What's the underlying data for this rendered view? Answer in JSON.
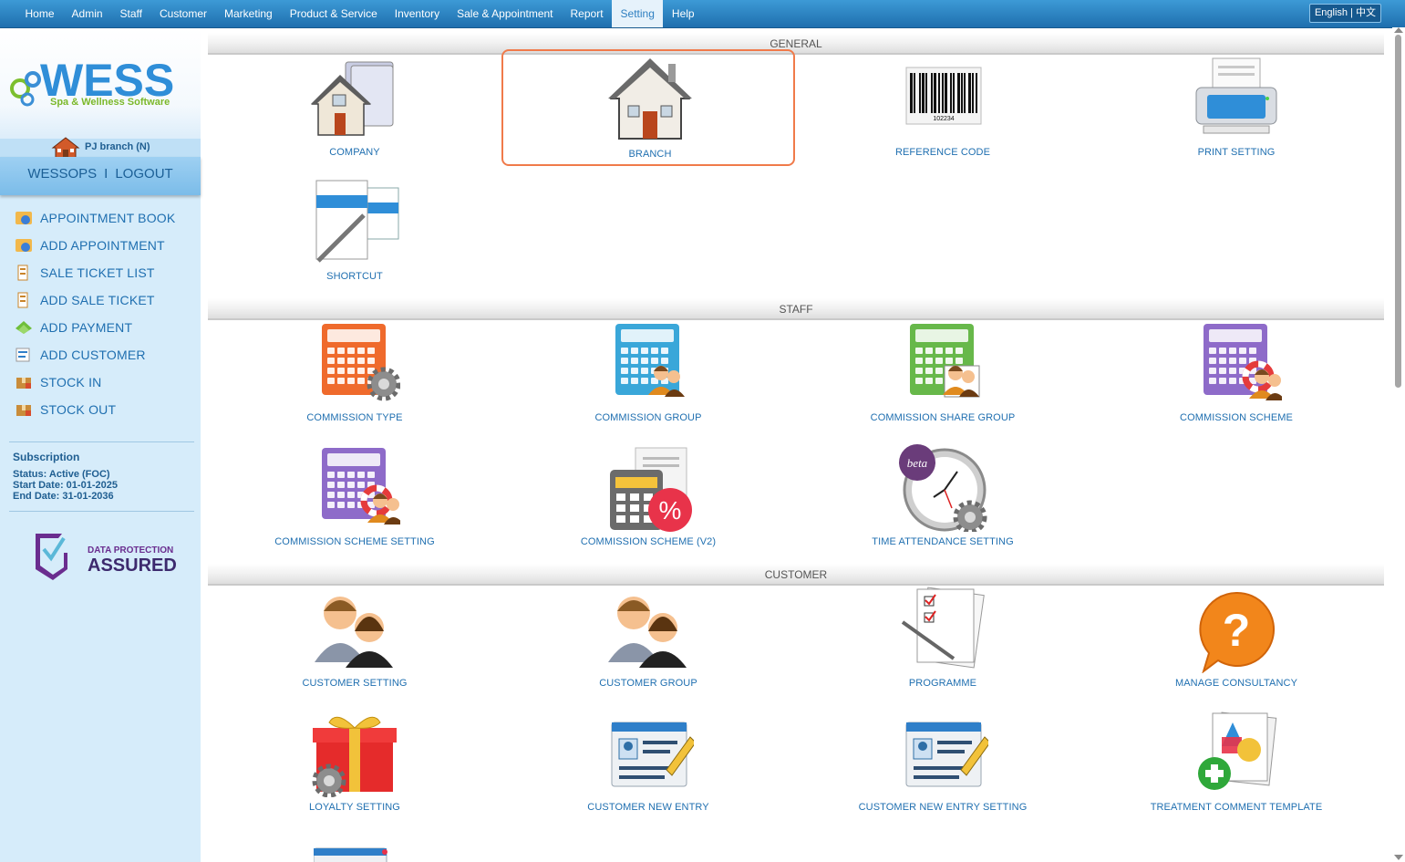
{
  "topnav": {
    "items": [
      "Home",
      "Admin",
      "Staff",
      "Customer",
      "Marketing",
      "Product & Service",
      "Inventory",
      "Sale & Appointment",
      "Report",
      "Setting",
      "Help"
    ],
    "active": "Setting",
    "language": "English | 中文"
  },
  "sidebar": {
    "logo": {
      "text": "WESS",
      "tagline": "Spa & Wellness Software"
    },
    "branch_name": "PJ branch (N)",
    "account": {
      "username": "WESSOPS",
      "separator": "I",
      "logout": "LOGOUT"
    },
    "menu": [
      {
        "label": "APPOINTMENT BOOK",
        "icon": "appointment-book-icon"
      },
      {
        "label": "ADD APPOINTMENT",
        "icon": "add-appointment-icon"
      },
      {
        "label": "SALE TICKET LIST",
        "icon": "sale-ticket-list-icon"
      },
      {
        "label": "ADD SALE TICKET",
        "icon": "add-sale-ticket-icon"
      },
      {
        "label": "ADD PAYMENT",
        "icon": "add-payment-icon"
      },
      {
        "label": "ADD CUSTOMER",
        "icon": "add-customer-icon"
      },
      {
        "label": "STOCK IN",
        "icon": "stock-in-icon"
      },
      {
        "label": "STOCK OUT",
        "icon": "stock-out-icon"
      }
    ],
    "subscription": {
      "title": "Subscription",
      "status": "Status: Active (FOC)",
      "start": "Start Date: 01-01-2025",
      "end": "End Date: 31-01-2036"
    },
    "badge": {
      "line1": "DATA PROTECTION",
      "line2": "ASSURED"
    }
  },
  "sections": [
    {
      "title": "GENERAL",
      "tiles": [
        {
          "label": "COMPANY",
          "icon": "company-icon"
        },
        {
          "label": "BRANCH",
          "icon": "branch-icon",
          "selected": true
        },
        {
          "label": "REFERENCE CODE",
          "icon": "barcode-icon",
          "barcode_number": "102234"
        },
        {
          "label": "PRINT SETTING",
          "icon": "printer-icon"
        },
        {
          "label": "SHORTCUT",
          "icon": "shortcut-icon"
        }
      ]
    },
    {
      "title": "STAFF",
      "tiles": [
        {
          "label": "COMMISSION TYPE",
          "icon": "commission-type-icon"
        },
        {
          "label": "COMMISSION GROUP",
          "icon": "commission-group-icon"
        },
        {
          "label": "COMMISSION SHARE GROUP",
          "icon": "commission-share-group-icon"
        },
        {
          "label": "COMMISSION SCHEME",
          "icon": "commission-scheme-icon"
        },
        {
          "label": "COMMISSION SCHEME SETTING",
          "icon": "commission-scheme-setting-icon"
        },
        {
          "label": "COMMISSION SCHEME (V2)",
          "icon": "commission-scheme-v2-icon"
        },
        {
          "label": "TIME ATTENDANCE SETTING",
          "icon": "time-attendance-icon",
          "badge": "beta"
        }
      ]
    },
    {
      "title": "CUSTOMER",
      "tiles": [
        {
          "label": "CUSTOMER SETTING",
          "icon": "customer-setting-icon"
        },
        {
          "label": "CUSTOMER GROUP",
          "icon": "customer-group-icon"
        },
        {
          "label": "PROGRAMME",
          "icon": "programme-icon"
        },
        {
          "label": "MANAGE CONSULTANCY",
          "icon": "consultancy-icon"
        },
        {
          "label": "LOYALTY SETTING",
          "icon": "loyalty-gift-icon"
        },
        {
          "label": "CUSTOMER NEW ENTRY",
          "icon": "customer-new-entry-icon"
        },
        {
          "label": "CUSTOMER NEW ENTRY SETTING",
          "icon": "customer-new-entry-setting-icon"
        },
        {
          "label": "TREATMENT COMMENT TEMPLATE",
          "icon": "treatment-comment-template-icon"
        }
      ]
    }
  ],
  "colors": {
    "nav": "#2b83c6",
    "sidebar": "#d6ecfa",
    "link": "#1f6fb0",
    "selected_border": "#f07a4a"
  }
}
